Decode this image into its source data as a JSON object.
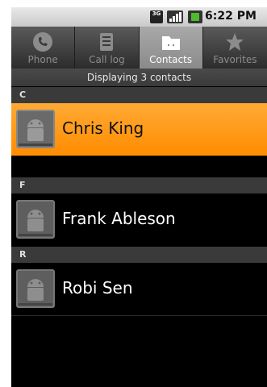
{
  "status_bar": {
    "network_badge": "3G",
    "time": "6:22 PM",
    "icons": [
      "3g-icon",
      "signal-icon",
      "battery-icon"
    ]
  },
  "tabs": [
    {
      "label": "Phone",
      "icon": "phone-icon",
      "selected": false
    },
    {
      "label": "Call log",
      "icon": "call-log-icon",
      "selected": false
    },
    {
      "label": "Contacts",
      "icon": "contacts-icon",
      "selected": true
    },
    {
      "label": "Favorites",
      "icon": "star-icon",
      "selected": false
    }
  ],
  "list_header": "Displaying 3 contacts",
  "sections": [
    {
      "letter": "C",
      "contacts": [
        {
          "name": "Chris King",
          "highlighted": true
        }
      ]
    },
    {
      "letter": "F",
      "contacts": [
        {
          "name": "Frank Ableson",
          "highlighted": false
        }
      ]
    },
    {
      "letter": "R",
      "contacts": [
        {
          "name": "Robi Sen",
          "highlighted": false
        }
      ]
    }
  ],
  "colors": {
    "highlight": "#ff8c00",
    "tab_selected": "#9a9a9a",
    "background": "#000000"
  }
}
